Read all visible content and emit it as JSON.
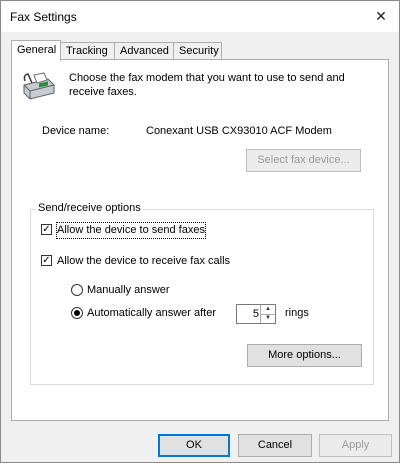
{
  "window": {
    "title": "Fax Settings"
  },
  "tabs": [
    "General",
    "Tracking",
    "Advanced",
    "Security"
  ],
  "intro": "Choose the fax modem that you want to use to send and receive faxes.",
  "device": {
    "label": "Device name:",
    "value": "Conexant USB CX93010 ACF Modem",
    "select_button": "Select fax device..."
  },
  "group": {
    "legend": "Send/receive options",
    "send_checkbox": {
      "label": "Allow the device to send faxes",
      "checked": true
    },
    "receive_checkbox": {
      "label": "Allow the device to receive fax calls",
      "checked": true
    },
    "manual_radio": {
      "label": "Manually answer",
      "selected": false
    },
    "auto_radio": {
      "label": "Automatically answer after",
      "selected": true
    },
    "rings_value": "5",
    "rings_label": "rings",
    "more_button": "More options..."
  },
  "footer": {
    "ok": "OK",
    "cancel": "Cancel",
    "apply": "Apply"
  },
  "icons": {
    "close": "close-icon",
    "fax": "fax-machine-icon",
    "spin_up": "spin-up-icon",
    "spin_down": "spin-down-icon"
  },
  "colors": {
    "accent": "#0078d7",
    "disabled_text": "#9a9a9a"
  }
}
